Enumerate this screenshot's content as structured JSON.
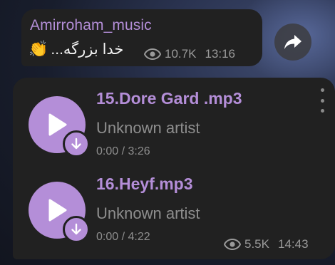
{
  "channel_post": {
    "channel_name": "Amirroham_music",
    "text": "خدا بزرگه...",
    "emoji": "👏",
    "views": "10.7K",
    "time": "13:16"
  },
  "audio_post": {
    "tracks": [
      {
        "title": "15.Dore Gard .mp3",
        "artist": "Unknown artist",
        "duration": "0:00 / 3:26"
      },
      {
        "title": "16.Heyf.mp3",
        "artist": "Unknown artist",
        "duration": "0:00 / 4:22"
      }
    ],
    "views": "5.5K",
    "time": "14:43"
  },
  "icons": {
    "share": "share-arrow-icon",
    "views": "eye-icon",
    "play": "play-icon",
    "download": "download-arrow-icon",
    "more": "more-vertical-icon"
  },
  "colors": {
    "accent": "#b48ed8",
    "bubble": "#212121",
    "secondary_text": "#8e8e8e"
  }
}
